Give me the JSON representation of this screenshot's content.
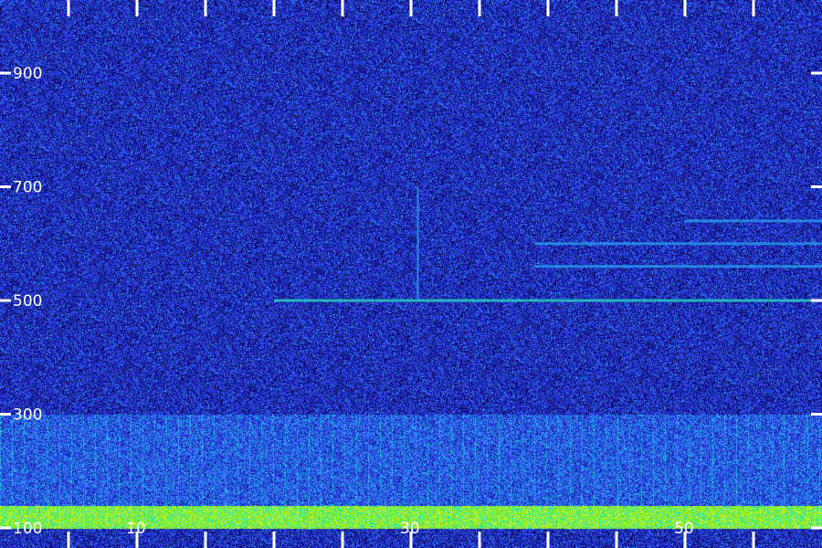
{
  "chart_data": {
    "type": "heatmap",
    "title": "",
    "xlabel": "",
    "ylabel": "",
    "ylim": [
      100,
      1080
    ],
    "xlim": [
      0,
      60
    ],
    "y_tick_labels": [
      "100",
      "300",
      "500",
      "700",
      "900"
    ],
    "y_ticks": [
      100,
      300,
      500,
      700,
      900
    ],
    "x_tick_labels": [
      "10",
      "30",
      "50"
    ],
    "x_ticks": [
      10,
      30,
      50
    ],
    "x_minor_ticks": [
      5,
      10,
      15,
      20,
      25,
      30,
      35,
      40,
      45,
      50,
      55
    ],
    "colormap": [
      "#08064a",
      "#1a1aa8",
      "#2f4ef0",
      "#2aa0f0",
      "#28e0c0",
      "#6cf02a",
      "#d0f020"
    ],
    "background_color": "#1a1466",
    "features": [
      {
        "kind": "band",
        "y_from": 100,
        "y_to": 140,
        "intensity": 0.85
      },
      {
        "kind": "band",
        "y_from": 140,
        "y_to": 300,
        "intensity": 0.35
      },
      {
        "kind": "line",
        "y": 500,
        "x_from": 20,
        "x_to": 60,
        "intensity": 0.7
      },
      {
        "kind": "line",
        "y": 560,
        "x_from": 39,
        "x_to": 60,
        "intensity": 0.45
      },
      {
        "kind": "line",
        "y": 600,
        "x_from": 39,
        "x_to": 60,
        "intensity": 0.45
      },
      {
        "kind": "line",
        "y": 640,
        "x_from": 50,
        "x_to": 60,
        "intensity": 0.45
      },
      {
        "kind": "vertical",
        "x": 30.5,
        "y_from": 500,
        "y_to": 700,
        "intensity": 0.55
      }
    ]
  }
}
